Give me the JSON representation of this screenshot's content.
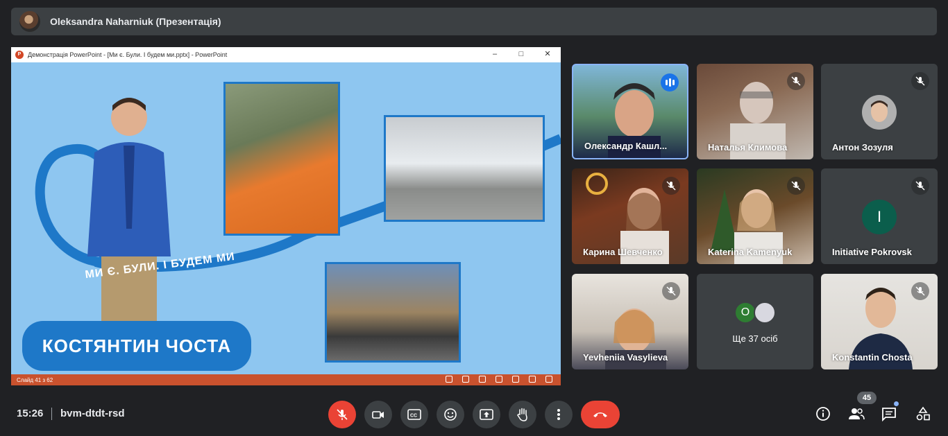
{
  "header": {
    "presenter_label": "Oleksandra Naharniuk (Презентація)"
  },
  "presentation": {
    "window_title": "Демонстрація PowerPoint - [Ми є. Були. І будем ми.pptx] - PowerPoint",
    "status_text": "Слайд 41 з 62",
    "slide": {
      "slogan": "МИ Є. БУЛИ. І БУДЕМ МИ",
      "name_banner": "КОСТЯНТИН ЧОСТА"
    }
  },
  "participants": [
    {
      "name": "Олександр Кашл...",
      "state": "speaking"
    },
    {
      "name": "Наталья Климова",
      "state": "muted"
    },
    {
      "name": "Антон Зозуля",
      "state": "muted"
    },
    {
      "name": "Карина Шевченко",
      "state": "muted"
    },
    {
      "name": "Katerina Kamenyuk",
      "state": "muted"
    },
    {
      "name": "Initiative Pokrovsk",
      "state": "muted",
      "initial": "I",
      "avatar_color": "#0b5e4c"
    },
    {
      "name": "Yevheniia Vasylieva",
      "state": "muted"
    },
    {
      "name": "Konstantin Chosta",
      "state": "muted"
    }
  ],
  "others_tile": {
    "text": "Ще 37 осіб",
    "initial": "O",
    "avatar_color": "#2e7d32"
  },
  "footer": {
    "time": "15:26",
    "meeting_code": "bvm-dtdt-rsd",
    "participant_count": "45"
  },
  "colors": {
    "end_call": "#ea4335",
    "active_border": "#8ab4f8",
    "slide_bg": "#8ec6f0"
  }
}
